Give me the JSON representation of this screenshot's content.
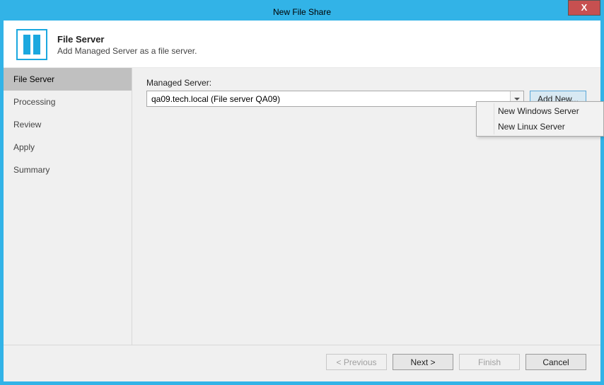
{
  "window": {
    "title": "New File Share",
    "close_symbol": "X"
  },
  "header": {
    "title": "File Server",
    "subtitle": "Add Managed Server as a file server."
  },
  "sidebar": {
    "steps": [
      {
        "label": "File Server",
        "active": true
      },
      {
        "label": "Processing",
        "active": false
      },
      {
        "label": "Review",
        "active": false
      },
      {
        "label": "Apply",
        "active": false
      },
      {
        "label": "Summary",
        "active": false
      }
    ]
  },
  "content": {
    "managed_server_label": "Managed Server:",
    "managed_server_value": "qa09.tech.local (File server QA09)",
    "add_new_button": "Add New..."
  },
  "popup": {
    "items": [
      {
        "label": "New Windows Server"
      },
      {
        "label": "New Linux Server"
      }
    ]
  },
  "footer": {
    "previous": "< Previous",
    "next": "Next >",
    "finish": "Finish",
    "cancel": "Cancel"
  }
}
